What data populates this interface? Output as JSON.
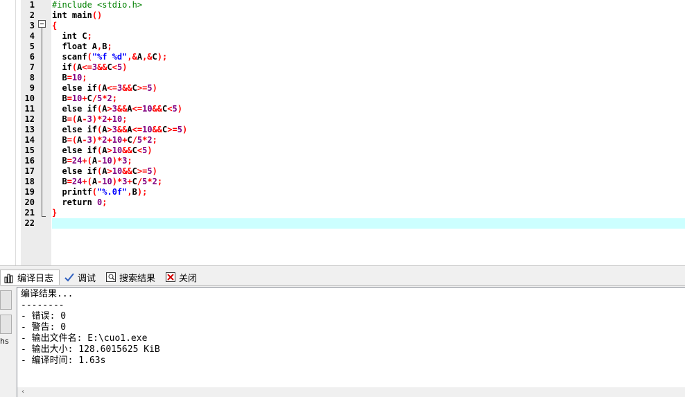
{
  "editor": {
    "line_numbers": [
      "1",
      "2",
      "3",
      "4",
      "5",
      "6",
      "7",
      "8",
      "9",
      "10",
      "11",
      "12",
      "13",
      "14",
      "15",
      "16",
      "17",
      "18",
      "19",
      "20",
      "21",
      "22"
    ],
    "lines": [
      [
        {
          "t": "#include <stdio.h>",
          "c": "pp"
        }
      ],
      [
        {
          "t": "int",
          "c": "kw"
        },
        {
          "t": " main",
          "c": ""
        },
        {
          "t": "()",
          "c": "sym"
        }
      ],
      [
        {
          "t": "{",
          "c": "sym"
        }
      ],
      [
        {
          "t": "  int",
          "c": "kw"
        },
        {
          "t": " C",
          "c": ""
        },
        {
          "t": ";",
          "c": "sym"
        }
      ],
      [
        {
          "t": "  float",
          "c": "kw"
        },
        {
          "t": " A",
          "c": ""
        },
        {
          "t": ",",
          "c": "sym"
        },
        {
          "t": "B",
          "c": ""
        },
        {
          "t": ";",
          "c": "sym"
        }
      ],
      [
        {
          "t": "  scanf",
          "c": ""
        },
        {
          "t": "(",
          "c": "sym"
        },
        {
          "t": "\"%f %d\"",
          "c": "str"
        },
        {
          "t": ",&",
          "c": "sym"
        },
        {
          "t": "A",
          "c": ""
        },
        {
          "t": ",&",
          "c": "sym"
        },
        {
          "t": "C",
          "c": ""
        },
        {
          "t": ");",
          "c": "sym"
        }
      ],
      [
        {
          "t": "  if",
          "c": "kw"
        },
        {
          "t": "(",
          "c": "sym"
        },
        {
          "t": "A",
          "c": ""
        },
        {
          "t": "<=",
          "c": "sym"
        },
        {
          "t": "3",
          "c": "num"
        },
        {
          "t": "&&",
          "c": "sym"
        },
        {
          "t": "C",
          "c": ""
        },
        {
          "t": "<",
          "c": "sym"
        },
        {
          "t": "5",
          "c": "num"
        },
        {
          "t": ")",
          "c": "sym"
        }
      ],
      [
        {
          "t": "  B",
          "c": ""
        },
        {
          "t": "=",
          "c": "sym"
        },
        {
          "t": "10",
          "c": "num"
        },
        {
          "t": ";",
          "c": "sym"
        }
      ],
      [
        {
          "t": "  else if",
          "c": "kw"
        },
        {
          "t": "(",
          "c": "sym"
        },
        {
          "t": "A",
          "c": ""
        },
        {
          "t": "<=",
          "c": "sym"
        },
        {
          "t": "3",
          "c": "num"
        },
        {
          "t": "&&",
          "c": "sym"
        },
        {
          "t": "C",
          "c": ""
        },
        {
          "t": ">=",
          "c": "sym"
        },
        {
          "t": "5",
          "c": "num"
        },
        {
          "t": ")",
          "c": "sym"
        }
      ],
      [
        {
          "t": "  B",
          "c": ""
        },
        {
          "t": "=",
          "c": "sym"
        },
        {
          "t": "10",
          "c": "num"
        },
        {
          "t": "+",
          "c": "sym"
        },
        {
          "t": "C",
          "c": ""
        },
        {
          "t": "/",
          "c": "sym"
        },
        {
          "t": "5",
          "c": "num"
        },
        {
          "t": "*",
          "c": "sym"
        },
        {
          "t": "2",
          "c": "num"
        },
        {
          "t": ";",
          "c": "sym"
        }
      ],
      [
        {
          "t": "  else if",
          "c": "kw"
        },
        {
          "t": "(",
          "c": "sym"
        },
        {
          "t": "A",
          "c": ""
        },
        {
          "t": ">",
          "c": "sym"
        },
        {
          "t": "3",
          "c": "num"
        },
        {
          "t": "&&",
          "c": "sym"
        },
        {
          "t": "A",
          "c": ""
        },
        {
          "t": "<=",
          "c": "sym"
        },
        {
          "t": "10",
          "c": "num"
        },
        {
          "t": "&&",
          "c": "sym"
        },
        {
          "t": "C",
          "c": ""
        },
        {
          "t": "<",
          "c": "sym"
        },
        {
          "t": "5",
          "c": "num"
        },
        {
          "t": ")",
          "c": "sym"
        }
      ],
      [
        {
          "t": "  B",
          "c": ""
        },
        {
          "t": "=(",
          "c": "sym"
        },
        {
          "t": "A",
          "c": ""
        },
        {
          "t": "-",
          "c": "sym"
        },
        {
          "t": "3",
          "c": "num"
        },
        {
          "t": ")*",
          "c": "sym"
        },
        {
          "t": "2",
          "c": "num"
        },
        {
          "t": "+",
          "c": "sym"
        },
        {
          "t": "10",
          "c": "num"
        },
        {
          "t": ";",
          "c": "sym"
        }
      ],
      [
        {
          "t": "  else if",
          "c": "kw"
        },
        {
          "t": "(",
          "c": "sym"
        },
        {
          "t": "A",
          "c": ""
        },
        {
          "t": ">",
          "c": "sym"
        },
        {
          "t": "3",
          "c": "num"
        },
        {
          "t": "&&",
          "c": "sym"
        },
        {
          "t": "A",
          "c": ""
        },
        {
          "t": "<=",
          "c": "sym"
        },
        {
          "t": "10",
          "c": "num"
        },
        {
          "t": "&&",
          "c": "sym"
        },
        {
          "t": "C",
          "c": ""
        },
        {
          "t": ">=",
          "c": "sym"
        },
        {
          "t": "5",
          "c": "num"
        },
        {
          "t": ")",
          "c": "sym"
        }
      ],
      [
        {
          "t": "  B",
          "c": ""
        },
        {
          "t": "=(",
          "c": "sym"
        },
        {
          "t": "A",
          "c": ""
        },
        {
          "t": "-",
          "c": "sym"
        },
        {
          "t": "3",
          "c": "num"
        },
        {
          "t": ")*",
          "c": "sym"
        },
        {
          "t": "2",
          "c": "num"
        },
        {
          "t": "+",
          "c": "sym"
        },
        {
          "t": "10",
          "c": "num"
        },
        {
          "t": "+",
          "c": "sym"
        },
        {
          "t": "C",
          "c": ""
        },
        {
          "t": "/",
          "c": "sym"
        },
        {
          "t": "5",
          "c": "num"
        },
        {
          "t": "*",
          "c": "sym"
        },
        {
          "t": "2",
          "c": "num"
        },
        {
          "t": ";",
          "c": "sym"
        }
      ],
      [
        {
          "t": "  else if",
          "c": "kw"
        },
        {
          "t": "(",
          "c": "sym"
        },
        {
          "t": "A",
          "c": ""
        },
        {
          "t": ">",
          "c": "sym"
        },
        {
          "t": "10",
          "c": "num"
        },
        {
          "t": "&&",
          "c": "sym"
        },
        {
          "t": "C",
          "c": ""
        },
        {
          "t": "<",
          "c": "sym"
        },
        {
          "t": "5",
          "c": "num"
        },
        {
          "t": ")",
          "c": "sym"
        }
      ],
      [
        {
          "t": "  B",
          "c": ""
        },
        {
          "t": "=",
          "c": "sym"
        },
        {
          "t": "24",
          "c": "num"
        },
        {
          "t": "+(",
          "c": "sym"
        },
        {
          "t": "A",
          "c": ""
        },
        {
          "t": "-",
          "c": "sym"
        },
        {
          "t": "10",
          "c": "num"
        },
        {
          "t": ")*",
          "c": "sym"
        },
        {
          "t": "3",
          "c": "num"
        },
        {
          "t": ";",
          "c": "sym"
        }
      ],
      [
        {
          "t": "  else if",
          "c": "kw"
        },
        {
          "t": "(",
          "c": "sym"
        },
        {
          "t": "A",
          "c": ""
        },
        {
          "t": ">",
          "c": "sym"
        },
        {
          "t": "10",
          "c": "num"
        },
        {
          "t": "&&",
          "c": "sym"
        },
        {
          "t": "C",
          "c": ""
        },
        {
          "t": ">=",
          "c": "sym"
        },
        {
          "t": "5",
          "c": "num"
        },
        {
          "t": ")",
          "c": "sym"
        }
      ],
      [
        {
          "t": "  B",
          "c": ""
        },
        {
          "t": "=",
          "c": "sym"
        },
        {
          "t": "24",
          "c": "num"
        },
        {
          "t": "+(",
          "c": "sym"
        },
        {
          "t": "A",
          "c": ""
        },
        {
          "t": "-",
          "c": "sym"
        },
        {
          "t": "10",
          "c": "num"
        },
        {
          "t": ")*",
          "c": "sym"
        },
        {
          "t": "3",
          "c": "num"
        },
        {
          "t": "+",
          "c": "sym"
        },
        {
          "t": "C",
          "c": ""
        },
        {
          "t": "/",
          "c": "sym"
        },
        {
          "t": "5",
          "c": "num"
        },
        {
          "t": "*",
          "c": "sym"
        },
        {
          "t": "2",
          "c": "num"
        },
        {
          "t": ";",
          "c": "sym"
        }
      ],
      [
        {
          "t": "  printf",
          "c": ""
        },
        {
          "t": "(",
          "c": "sym"
        },
        {
          "t": "\"%.0f\"",
          "c": "str"
        },
        {
          "t": ",",
          "c": "sym"
        },
        {
          "t": "B",
          "c": ""
        },
        {
          "t": ");",
          "c": "sym"
        }
      ],
      [
        {
          "t": "  return",
          "c": "kw"
        },
        {
          "t": " ",
          "c": ""
        },
        {
          "t": "0",
          "c": "num"
        },
        {
          "t": ";",
          "c": "sym"
        }
      ],
      [
        {
          "t": "}",
          "c": "sym"
        }
      ],
      []
    ],
    "current_line": 22
  },
  "tabs": [
    {
      "label": "编译日志",
      "icon": "bar-chart-icon",
      "active": true
    },
    {
      "label": "调试",
      "icon": "checkmark-icon",
      "active": false
    },
    {
      "label": "搜索结果",
      "icon": "search-results-icon",
      "active": false
    },
    {
      "label": "关闭",
      "icon": "close-panel-icon",
      "active": false
    }
  ],
  "side_panel": {
    "text": "hs"
  },
  "log": {
    "lines": [
      "编译结果...",
      "--------",
      "- 错误: 0",
      "- 警告: 0",
      "- 输出文件名: E:\\cuo1.exe",
      "- 输出大小: 128.6015625 KiB",
      "- 编译时间: 1.63s"
    ]
  },
  "colors": {
    "keyword": "#000000",
    "preprocessor": "#008000",
    "symbol": "#ff0000",
    "number": "#800080",
    "string": "#0000ff",
    "current_line": "#ccffff"
  }
}
